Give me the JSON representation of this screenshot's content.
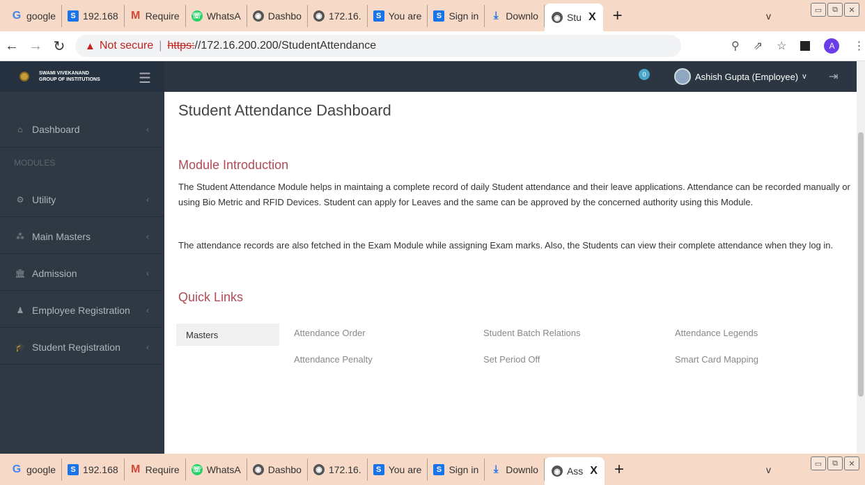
{
  "browser": {
    "tabs": [
      {
        "label": "google",
        "icon": "google-icon"
      },
      {
        "label": "192.168",
        "icon": "s-icon"
      },
      {
        "label": "Require",
        "icon": "gmail-icon"
      },
      {
        "label": "WhatsA",
        "icon": "whatsapp-icon"
      },
      {
        "label": "Dashbo",
        "icon": "globe-icon"
      },
      {
        "label": "172.16.",
        "icon": "globe-icon"
      },
      {
        "label": "You are",
        "icon": "s-icon"
      },
      {
        "label": "Sign in",
        "icon": "s-icon"
      },
      {
        "label": "Downlo",
        "icon": "download-icon"
      }
    ],
    "active_tab_top": "Stu",
    "active_tab_bottom": "Ass",
    "close_glyph": "X",
    "new_tab_glyph": "+",
    "tab_dropdown_glyph": "v",
    "address": {
      "not_secure": "Not secure",
      "scheme": "https:",
      "path": "//172.16.200.200/StudentAttendance"
    },
    "profile_initial": "A"
  },
  "app": {
    "brand_line1": "SWAMI VIVEKANAND",
    "brand_line2": "GROUP OF INSTITUTIONS",
    "notification_count": "0",
    "user_name": "Ashish Gupta (Employee)",
    "user_chevron": "v",
    "sidebar": {
      "dashboard": "Dashboard",
      "modules_header": "MODULES",
      "items": [
        "Utility",
        "Main Masters",
        "Admission",
        "Employee Registration",
        "Student Registration"
      ]
    },
    "content": {
      "title": "Student Attendance Dashboard",
      "module_intro_heading": "Module Introduction",
      "para1": "The Student Attendance Module helps in maintaing a complete record of daily Student attendance and their leave applications. Attendance can be recorded manually or using Bio Metric and RFID Devices. Student can apply for Leaves and the same can be approved by the concerned authority using this Module.",
      "para2": "The attendance records are also fetched in the Exam Module while assigning Exam marks. Also, the Students can view their complete attendance when they log in.",
      "quick_links_heading": "Quick Links",
      "quick_links_category": "Masters",
      "quick_links": {
        "col1": [
          "Attendance Order",
          "Attendance Penalty"
        ],
        "col2": [
          "Student Batch Relations",
          "Set Period Off"
        ],
        "col3": [
          "Attendance Legends",
          "Smart Card Mapping"
        ]
      }
    }
  }
}
